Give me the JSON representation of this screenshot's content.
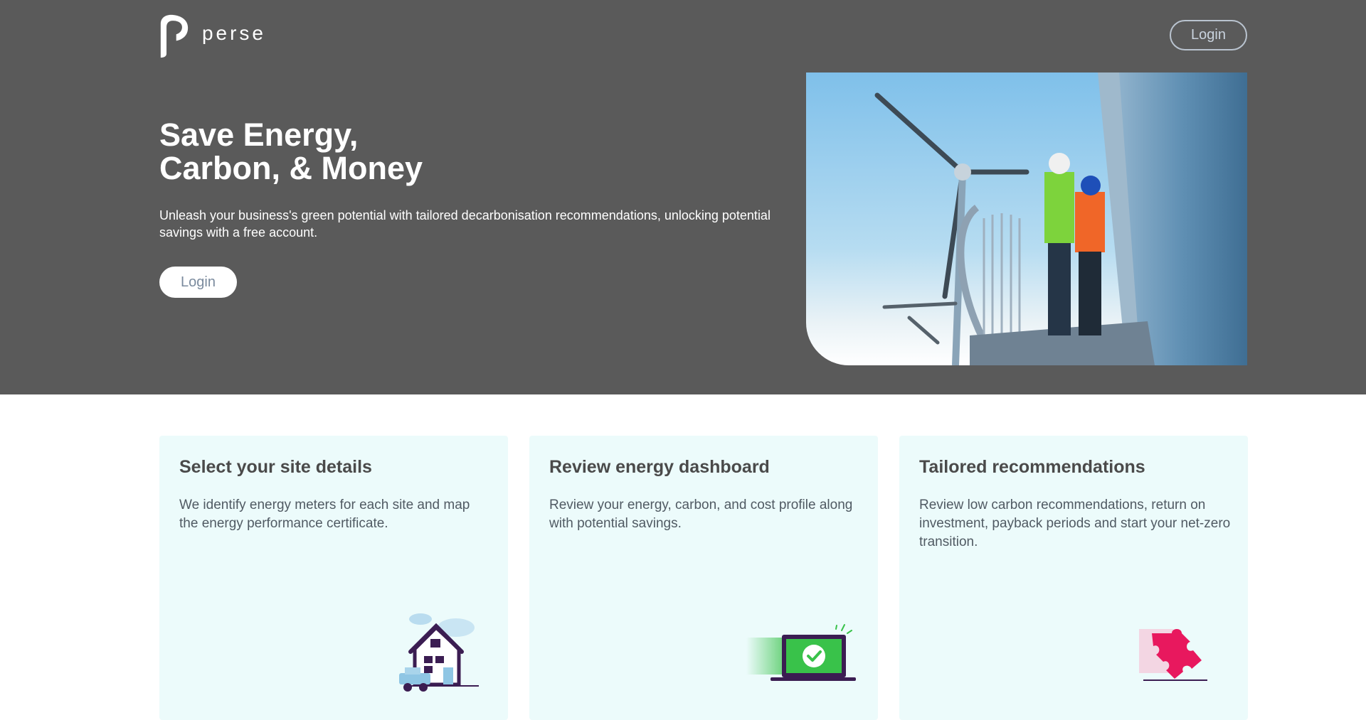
{
  "header": {
    "logo_text": "perse",
    "login_label": "Login"
  },
  "hero": {
    "title_line1": "Save Energy,",
    "title_line2": "Carbon, & Money",
    "description": "Unleash your business's green potential with tailored decarbonisation recommendations, unlocking potential savings with a free account.",
    "login_label": "Login",
    "image": "wind-turbine-workers-photo"
  },
  "cards": [
    {
      "title": "Select your site details",
      "text": "We identify energy meters for each site and map the energy performance certificate.",
      "icon": "house-icon"
    },
    {
      "title": "Review energy dashboard",
      "text": "Review your energy, carbon, and cost profile along with potential savings.",
      "icon": "laptop-check-icon"
    },
    {
      "title": "Tailored recommendations",
      "text": "Review low carbon recommendations, return on investment, payback periods and start your net-zero transition.",
      "icon": "puzzle-piece-icon"
    }
  ],
  "colors": {
    "hero_bg": "#5a5a5a",
    "card_bg": "#ecfbfb",
    "accent_green": "#39c24a",
    "accent_purple": "#3b1d52",
    "accent_pink": "#e8185e"
  }
}
